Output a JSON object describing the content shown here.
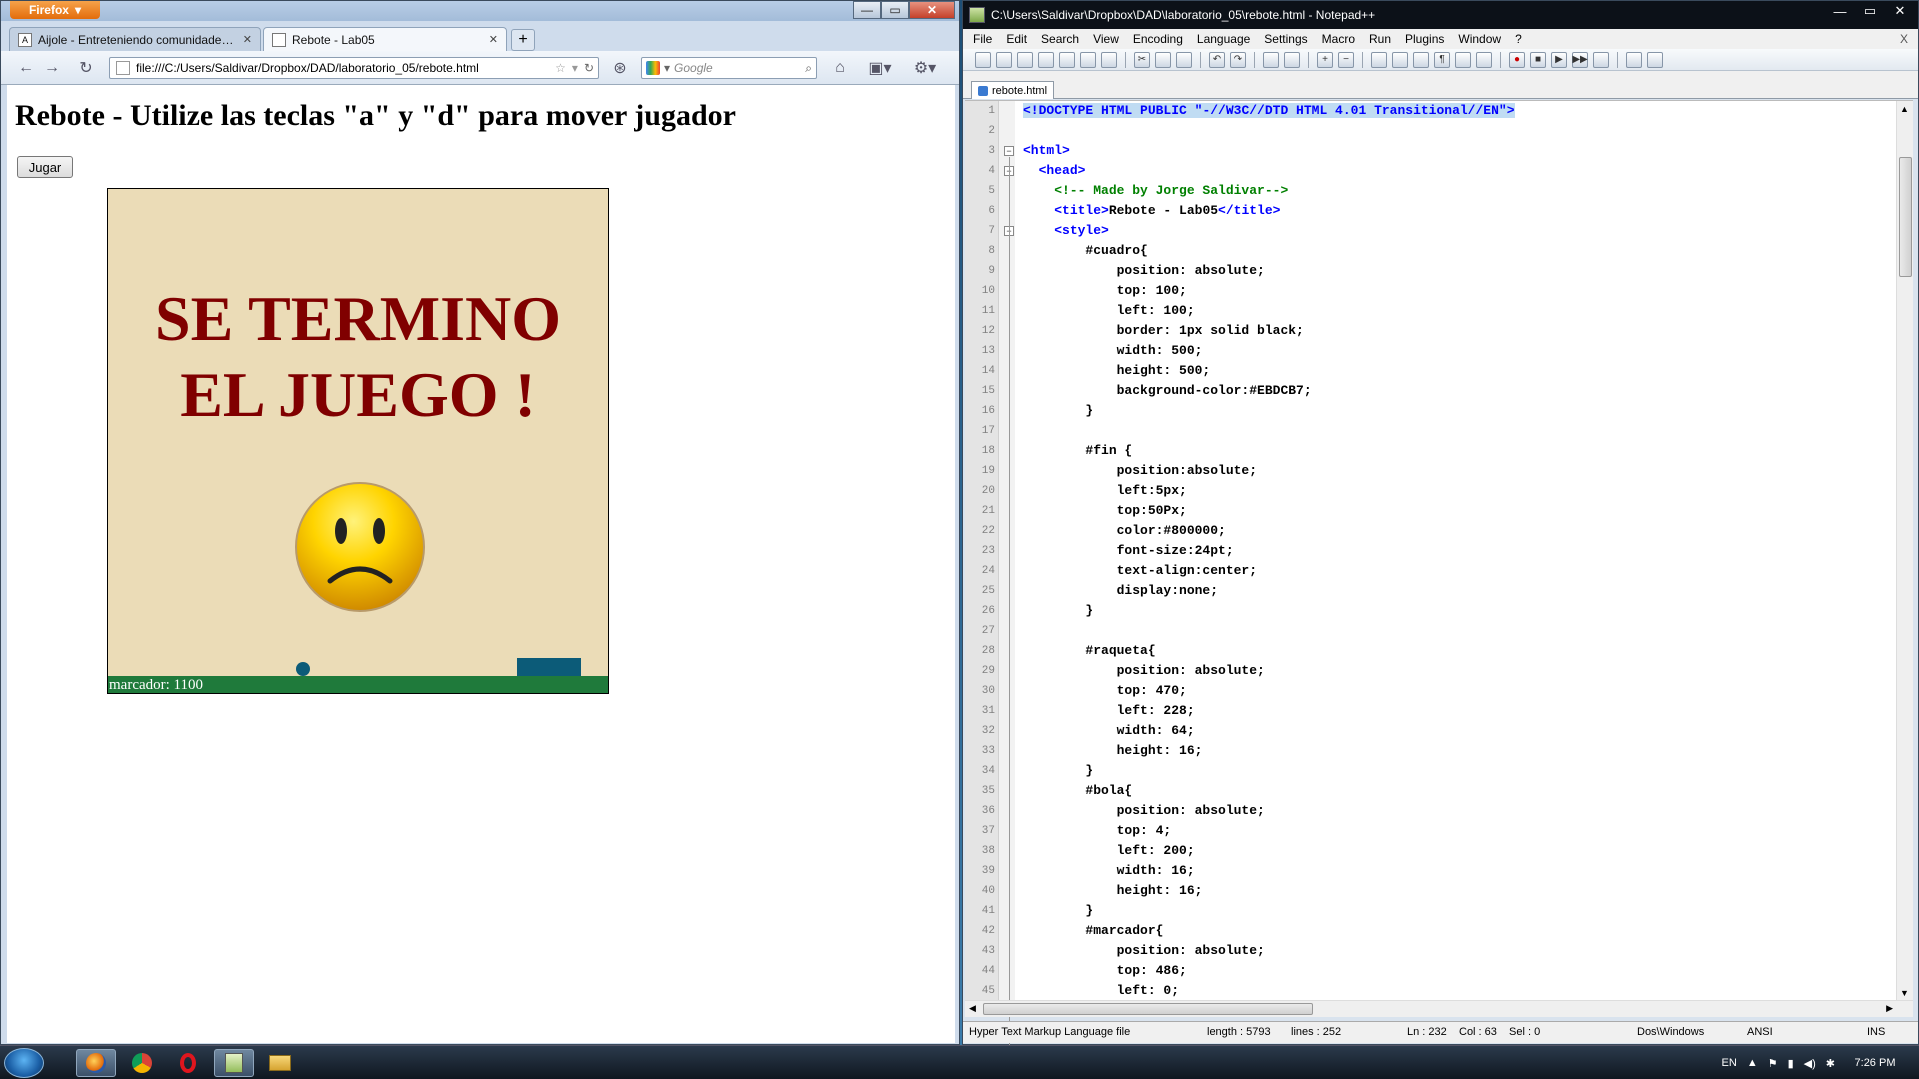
{
  "firefox": {
    "button_label": "Firefox",
    "tabs": [
      {
        "title": "Aijole - Entreteniendo comunidades ...",
        "icon": "aijole-favicon"
      },
      {
        "title": "Rebote - Lab05",
        "icon": "page-favicon"
      }
    ],
    "address": "file:///C:/Users/Saldivar/Dropbox/DAD/laboratorio_05/rebote.html",
    "search_placeholder": "Google"
  },
  "page": {
    "heading": "Rebote - Utilize las teclas \"a\" y \"d\" para mover jugador",
    "play_button": "Jugar",
    "game_over_line1": "SE TERMINO",
    "game_over_line2": "EL JUEGO !",
    "score": "marcador: 1100",
    "colors": {
      "board": "#EBDCB7",
      "message": "#800000",
      "bar": "#1f7a3b",
      "paddle": "#0c5b78"
    }
  },
  "notepad": {
    "title": "C:\\Users\\Saldivar\\Dropbox\\DAD\\laboratorio_05\\rebote.html - Notepad++",
    "menu": [
      "File",
      "Edit",
      "Search",
      "View",
      "Encoding",
      "Language",
      "Settings",
      "Macro",
      "Run",
      "Plugins",
      "Window",
      "?"
    ],
    "tab": "rebote.html",
    "lines": [
      "<!DOCTYPE HTML PUBLIC \"-//W3C//DTD HTML 4.01 Transitional//EN\">",
      "",
      "<html>",
      "  <head>",
      "    <!-- Made by Jorge Saldivar-->",
      "    <title>Rebote - Lab05</title>",
      "    <style>",
      "        #cuadro{",
      "            position: absolute;",
      "            top: 100;",
      "            left: 100;",
      "            border: 1px solid black;",
      "            width: 500;",
      "            height: 500;",
      "            background-color:#EBDCB7;",
      "        }",
      "",
      "        #fin {",
      "            position:absolute;",
      "            left:5px;",
      "            top:50Px;",
      "            color:#800000;",
      "            font-size:24pt;",
      "            text-align:center;",
      "            display:none;",
      "        }",
      "",
      "        #raqueta{",
      "            position: absolute;",
      "            top: 470;",
      "            left: 228;",
      "            width: 64;",
      "            height: 16;",
      "        }",
      "        #bola{",
      "            position: absolute;",
      "            top: 4;",
      "            left: 200;",
      "            width: 16;",
      "            height: 16;",
      "        }",
      "        #marcador{",
      "            position: absolute;",
      "            top: 486;",
      "            left: 0;"
    ],
    "status": {
      "file_type": "Hyper Text Markup Language file",
      "length": "length : 5793",
      "lines": "lines : 252",
      "ln": "Ln : 232",
      "col": "Col : 63",
      "sel": "Sel : 0",
      "eol": "Dos\\Windows",
      "encoding": "ANSI",
      "mode": "INS"
    }
  },
  "taskbar": {
    "lang": "EN",
    "time": "7:26 PM",
    "apps": [
      "firefox-icon",
      "chrome-icon",
      "opera-icon",
      "notepadpp-icon",
      "explorer-icon"
    ]
  }
}
